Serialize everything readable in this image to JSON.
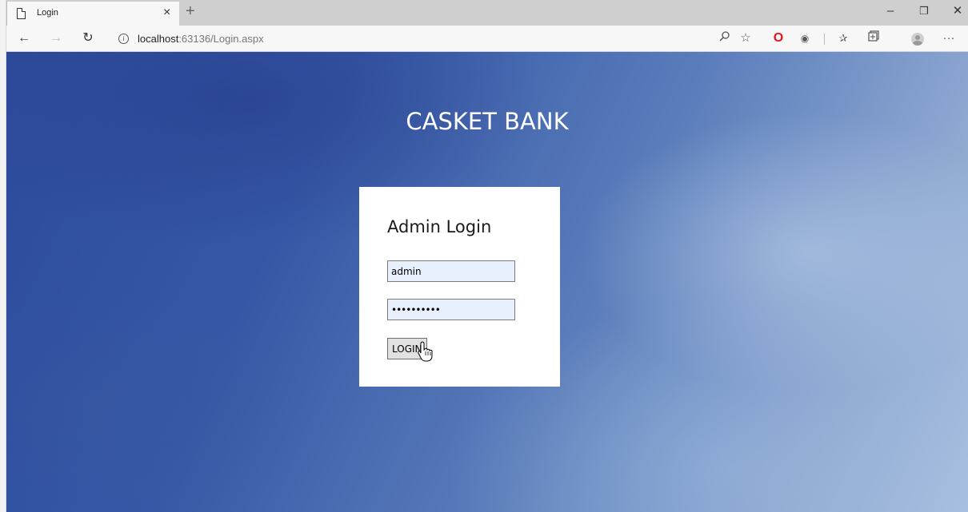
{
  "browser": {
    "tab_title": "Login",
    "tab_close": "×",
    "new_tab": "+",
    "window_controls": {
      "minimize": "–",
      "restore": "❐",
      "close": "✕"
    },
    "nav": {
      "back": "←",
      "forward": "→",
      "refresh": "↻"
    },
    "address": {
      "host": "localhost",
      "port_path": ":63136/Login.aspx"
    },
    "toolbar_icons": [
      "zoom-icon",
      "favorite-star-icon",
      "opera-icon",
      "extension-icon",
      "favorites-bar-icon",
      "collections-icon",
      "profile-avatar-icon",
      "more-menu-icon"
    ]
  },
  "page": {
    "site_title": "CASKET BANK",
    "login": {
      "heading": "Admin Login",
      "username_value": "admin",
      "password_value": "••••••••••",
      "button_label": "LOGIN"
    }
  },
  "colors": {
    "background_dark": "#2d4a9c",
    "background_light": "#a9c0e0",
    "input_autofill": "#e8f0fe",
    "opera_red": "#e0161e"
  }
}
